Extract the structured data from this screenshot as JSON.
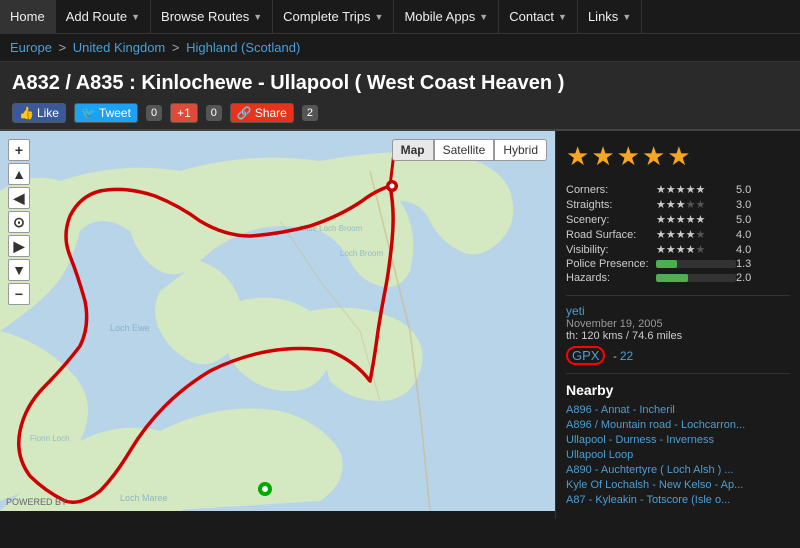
{
  "navbar": {
    "items": [
      {
        "label": "Home",
        "hasDropdown": false,
        "id": "home"
      },
      {
        "label": "Add Route",
        "hasDropdown": true,
        "id": "add-route"
      },
      {
        "label": "Browse Routes",
        "hasDropdown": true,
        "id": "browse-routes"
      },
      {
        "label": "Complete Trips",
        "hasDropdown": true,
        "id": "complete-trips"
      },
      {
        "label": "Mobile Apps",
        "hasDropdown": true,
        "id": "mobile-apps"
      },
      {
        "label": "Contact",
        "hasDropdown": true,
        "id": "contact"
      },
      {
        "label": "Links",
        "hasDropdown": true,
        "id": "links"
      }
    ]
  },
  "breadcrumb": {
    "items": [
      {
        "label": "Europe",
        "href": "#"
      },
      {
        "label": "United Kingdom",
        "href": "#"
      },
      {
        "label": "Highland (Scotland)",
        "href": "#"
      }
    ]
  },
  "page": {
    "title": "A832 / A835 : Kinlochewe - Ullapool ( West Coast Heaven )",
    "social": {
      "like_label": "Like",
      "tweet_label": "Tweet",
      "tweet_count": "0",
      "gplus_label": "+1",
      "gplus_count": "0",
      "share_label": "Share",
      "share_count": "2"
    }
  },
  "map": {
    "type_buttons": [
      "Map",
      "Satellite",
      "Hybrid"
    ],
    "active_type": "Map",
    "controls": [
      "+",
      "−"
    ],
    "powered_by": "POWERED BY"
  },
  "sidebar": {
    "overall_stars": 4.5,
    "ratings": [
      {
        "label": "Corners:",
        "stars": "★★★★★",
        "value": "5.0",
        "pct": 100
      },
      {
        "label": "Straights:",
        "stars": "★★★☆☆",
        "value": "3.0",
        "pct": 60
      },
      {
        "label": "Scenery:",
        "stars": "★★★★★",
        "value": "5.0",
        "pct": 100
      },
      {
        "label": "Road Surface:",
        "stars": "★★★★☆",
        "value": "4.0",
        "pct": 80
      },
      {
        "label": "Visibility:",
        "stars": "★★★★☆",
        "value": "4.0",
        "pct": 80
      },
      {
        "label": "Police Presence:",
        "stars": "",
        "value": "1.3",
        "pct": 26
      },
      {
        "label": "Hazards:",
        "stars": "",
        "value": "2.0",
        "pct": 40
      }
    ],
    "user": {
      "name": "yeti",
      "date": "November 19, 2005",
      "distance_label": "th: 120 kms / 74.6 miles",
      "gpx_label": "GPX",
      "gpx_extra": "22"
    },
    "nearby": {
      "title": "Nearby",
      "links": [
        "A896 - Annat - Incheril",
        "A896 / Mountain road - Lochcarron...",
        "Ullapool - Durness - Inverness",
        "Ullapool Loop",
        "A890 - Auchtertyre ( Loch Alsh ) ...",
        "Kyle Of Lochalsh - New Kelso - Ap...",
        "A87 - Kyleakin - Totscore (Isle o..."
      ]
    }
  }
}
